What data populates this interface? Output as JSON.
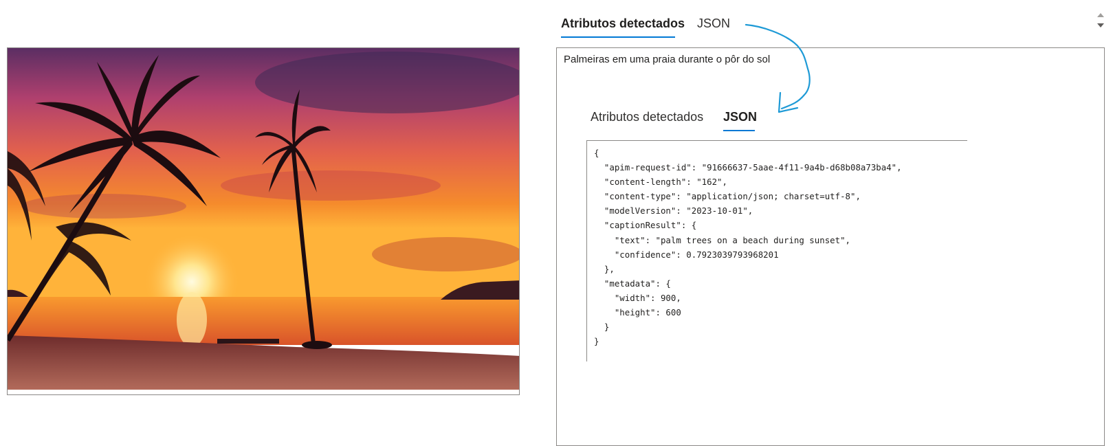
{
  "tabs_top": {
    "attributes_label": "Atributos detectados",
    "json_label": "JSON"
  },
  "caption": "Palmeiras em uma praia durante o pôr do sol",
  "tabs_inner": {
    "attributes_label": "Atributos detectados",
    "json_label": "JSON"
  },
  "json_output": "{\n  \"apim-request-id\": \"91666637-5aae-4f11-9a4b-d68b08a73ba4\",\n  \"content-length\": \"162\",\n  \"content-type\": \"application/json; charset=utf-8\",\n  \"modelVersion\": \"2023-10-01\",\n  \"captionResult\": {\n    \"text\": \"palm trees on a beach during sunset\",\n    \"confidence\": 0.7923039793968201\n  },\n  \"metadata\": {\n    \"width\": 900,\n    \"height\": 600\n  }\n}",
  "colors": {
    "accent": "#0078d4",
    "annotation": "#1e9ad6",
    "border": "#8a8886"
  }
}
